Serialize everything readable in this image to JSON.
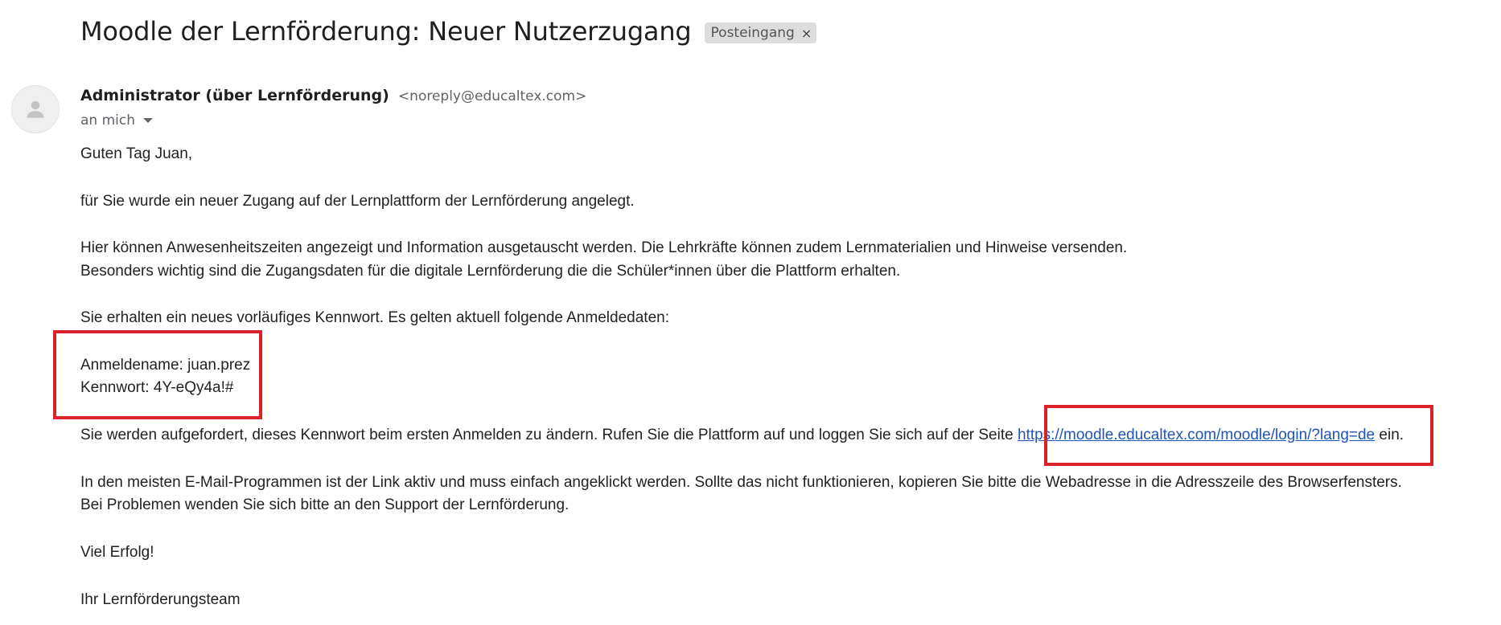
{
  "email": {
    "subject": "Moodle der Lernförderung: Neuer Nutzerzugang",
    "label": "Posteingang",
    "label_remove": "×",
    "sender_name": "Administrator (über Lernförderung)",
    "sender_email": "<noreply@educaltex.com>",
    "recipient": "an mich",
    "body": {
      "greeting": "Guten Tag Juan,",
      "p1": "für Sie wurde ein neuer Zugang auf der Lernplattform der Lernförderung angelegt.",
      "p2_l1": "Hier können Anwesenheitszeiten angezeigt und Information ausgetauscht werden. Die Lehrkräfte können zudem Lernmaterialien und Hinweise versenden.",
      "p2_l2": "Besonders wichtig sind die Zugangsdaten für die digitale Lernförderung die die Schüler*innen über die Plattform erhalten.",
      "p3": "Sie erhalten ein neues vorläufiges Kennwort. Es gelten aktuell folgende Anmeldedaten:",
      "username_line": "Anmeldename: juan.prez",
      "password_line": "Kennwort: 4Y-eQy4a!#",
      "p4_before": "Sie werden aufgefordert, dieses Kennwort beim ersten Anmelden zu ändern. Rufen Sie die Plattform auf und loggen Sie sich auf der Seite ",
      "p4_link": "https://moodle.educaltex.com/moodle/login/?lang=de",
      "p4_after": " ein.",
      "p5_l1": "In den meisten E-Mail-Programmen ist der Link aktiv und muss einfach angeklickt werden. Sollte das nicht funktionieren, kopieren Sie bitte die Webadresse in die Adresszeile des Browserfensters.",
      "p5_l2": "Bei Problemen wenden Sie sich bitte an den Support der Lernförderung.",
      "closing": "Viel Erfolg!",
      "signature": "Ihr Lernförderungsteam"
    }
  },
  "colors": {
    "highlight": "#d9222a",
    "link": "#1f54b8"
  },
  "icons": {
    "avatar": "person-icon",
    "label_remove": "close-icon",
    "recipient_toggle": "chevron-down-icon"
  }
}
